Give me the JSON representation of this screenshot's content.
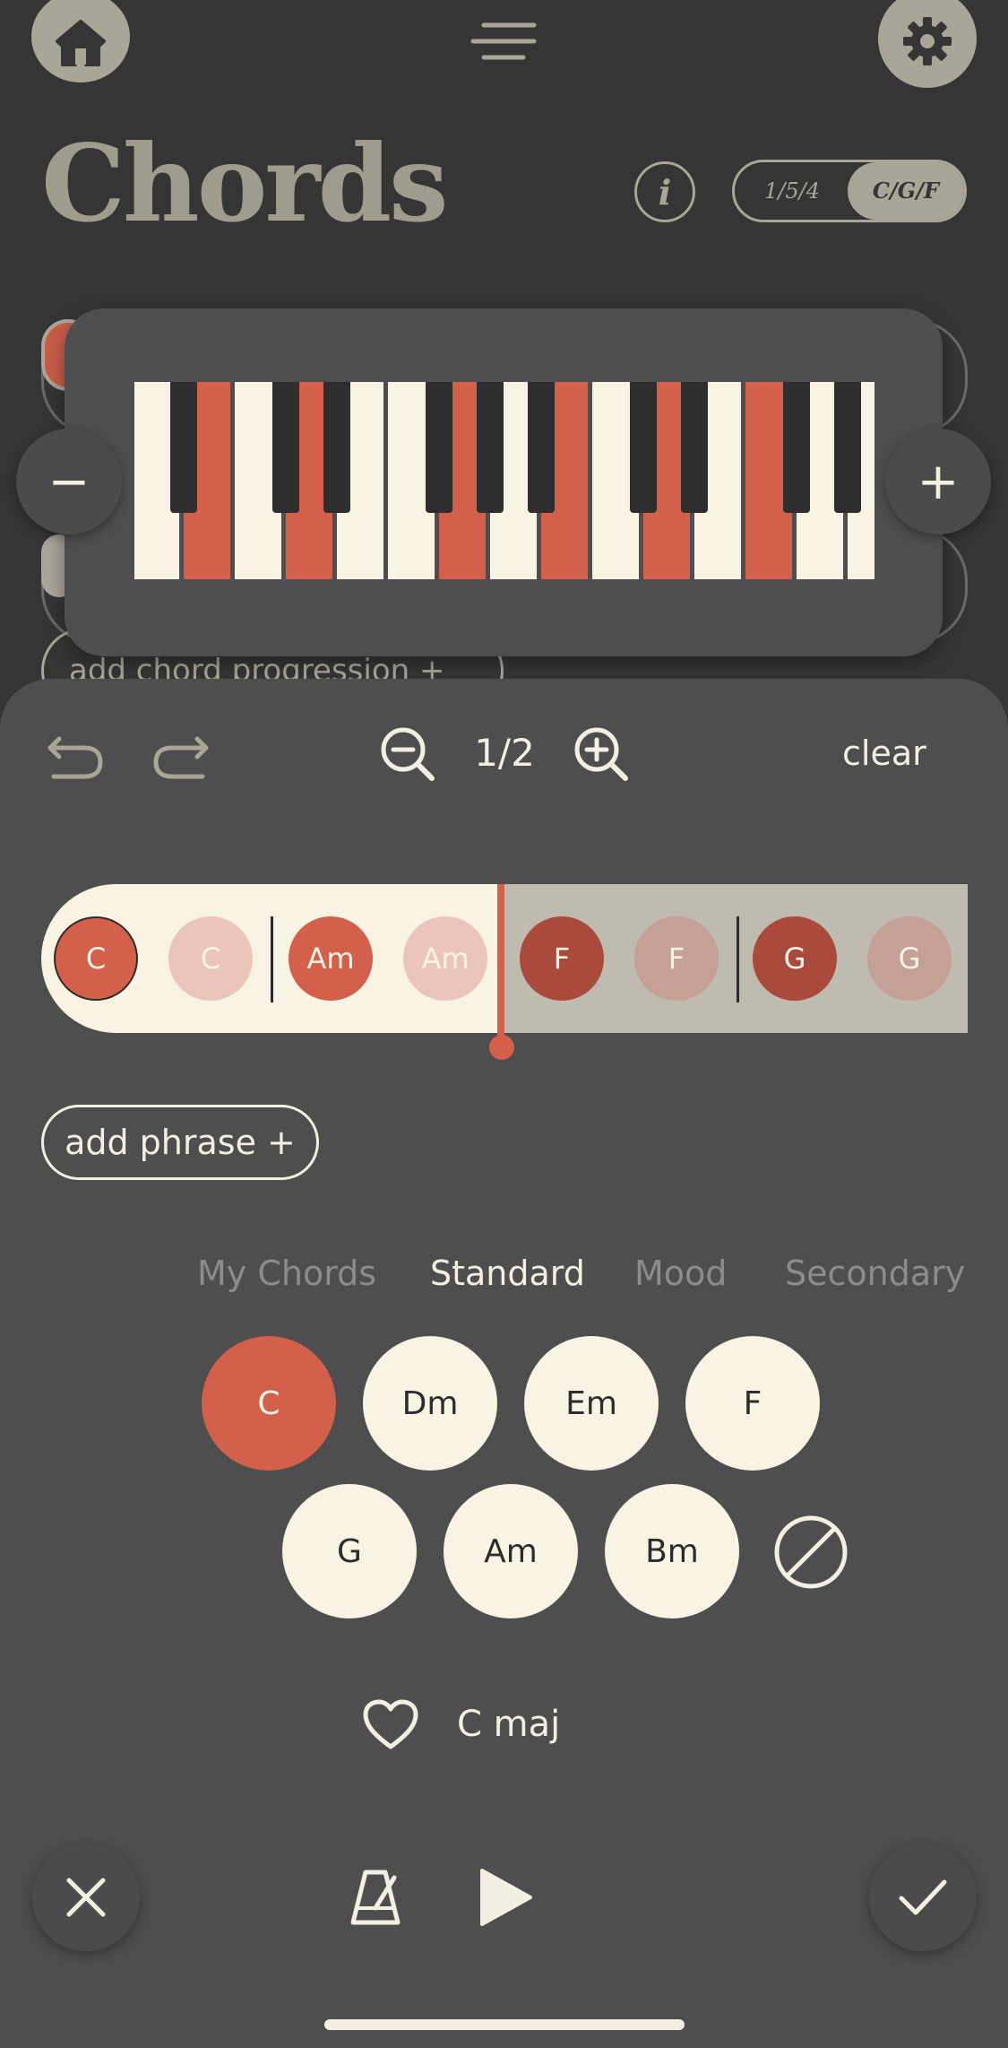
{
  "header": {
    "title": "Chords",
    "toggle_options": [
      "1/5/4",
      "C/G/F"
    ],
    "toggle_selected": "C/G/F",
    "info_label": "i"
  },
  "background": {
    "add_progression_label": "add chord progression  +"
  },
  "toolbar": {
    "zoom_level": "1/2",
    "clear_label": "clear"
  },
  "timeline": {
    "chords": [
      {
        "label": "C",
        "state": "active"
      },
      {
        "label": "C",
        "state": "hold"
      },
      {
        "label": "Am",
        "state": "active"
      },
      {
        "label": "Am",
        "state": "hold"
      },
      {
        "label": "F",
        "state": "active"
      },
      {
        "label": "F",
        "state": "hold"
      },
      {
        "label": "G",
        "state": "active"
      },
      {
        "label": "G",
        "state": "hold"
      }
    ],
    "playhead_position": 0.5
  },
  "add_phrase_label": "add phrase  +",
  "tabs": [
    {
      "label": "My Chords",
      "active": false
    },
    {
      "label": "Standard",
      "active": true
    },
    {
      "label": "Mood",
      "active": false
    },
    {
      "label": "Secondary",
      "active": false
    }
  ],
  "palette": {
    "row1": [
      "C",
      "Dm",
      "Em",
      "F"
    ],
    "row2": [
      "G",
      "Am",
      "Bm"
    ],
    "selected": "C"
  },
  "selected_chord_name": "C maj",
  "colors": {
    "accent": "#d3604b",
    "cream": "#f8f3e2",
    "background": "#353535",
    "sheet": "#4e4e4e"
  }
}
